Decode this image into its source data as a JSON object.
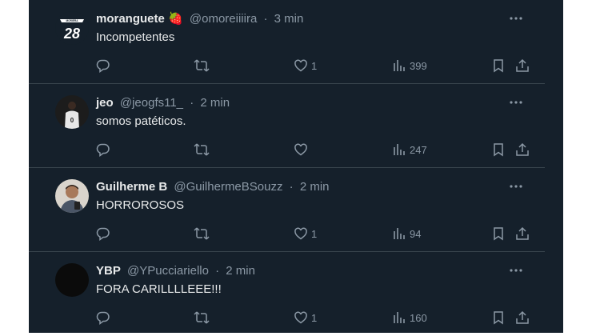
{
  "tweets": [
    {
      "name": "moranguete",
      "name_emoji": "🍓",
      "handle": "@omoreiiiira",
      "time": "3 min",
      "text": "Incompetentes",
      "likes": "1",
      "views": "399",
      "avatar": "jersey-28-avatar"
    },
    {
      "name": "jeo",
      "handle": "@jeogfs11_",
      "time": "2 min",
      "text": "somos patéticos.",
      "likes": "",
      "views": "247",
      "avatar": "player-photo-avatar"
    },
    {
      "name": "Guilherme B",
      "handle": "@GuilhermeBSouzz",
      "time": "2 min",
      "text": "HORROROSOS",
      "likes": "1",
      "views": "94",
      "avatar": "person-photo-avatar"
    },
    {
      "name": "YBP",
      "handle": "@YPucciariello",
      "time": "2 min",
      "text": "FORA CARILLLLEEE!!!",
      "likes": "1",
      "views": "160",
      "avatar": "dark-avatar"
    }
  ],
  "separator": "·",
  "colors": {
    "background": "#15202b",
    "text": "#e7e9ea",
    "muted": "#8b98a5",
    "border": "#38444d"
  },
  "icons": [
    "reply-icon",
    "retweet-icon",
    "like-icon",
    "views-icon",
    "bookmark-icon",
    "share-icon",
    "more-icon"
  ]
}
